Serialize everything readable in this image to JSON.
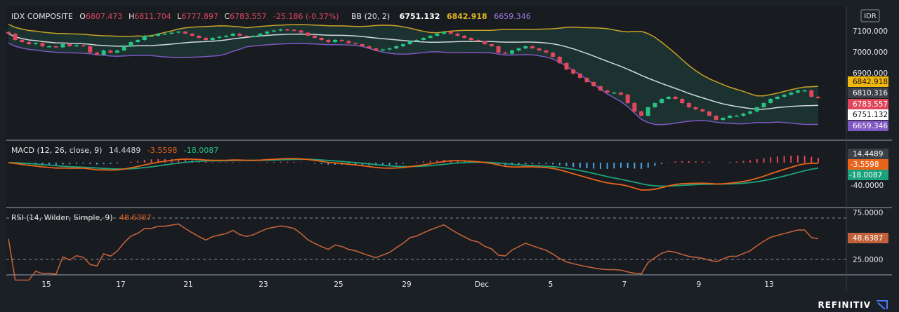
{
  "header": {
    "symbol": "IDX COMPOSITE",
    "o_label": "O",
    "o_value": "6807.473",
    "h_label": "H",
    "h_value": "6811.704",
    "l_label": "L",
    "l_value": "6777.897",
    "c_label": "C",
    "c_value": "6783.557",
    "change": "-25.186 (-0.37%)",
    "bb_label": "BB (20, 2)",
    "bb_mid": "6751.132",
    "bb_upper": "6842.918",
    "bb_lower": "6659.346",
    "currency": "IDR"
  },
  "macd_header": {
    "label": "MACD (12, 26, close, 9)",
    "hist": "14.4489",
    "macd": "-3.5598",
    "signal": "-18.0087"
  },
  "rsi_header": {
    "label": "RSI (14, Wilder, Simple, 9)",
    "value": "48.6387"
  },
  "price_axis": {
    "ticks": [
      "7100.000",
      "7000.000",
      "6900.000"
    ]
  },
  "price_tags": {
    "bb_upper": "6842.918",
    "last_rsi_ma": "6810.316",
    "close": "6783.557",
    "bb_mid": "6751.132",
    "bb_lower": "6659.346"
  },
  "macd_axis": {
    "hist": "14.4489",
    "macd": "-3.5598",
    "signal": "-18.0087",
    "tick": "-40.0000"
  },
  "rsi_axis": {
    "upper": "75.0000",
    "value": "48.6387",
    "lower": "25.0000"
  },
  "x_axis": {
    "labels": [
      "15",
      "17",
      "21",
      "23",
      "25",
      "29",
      "Dec",
      "5",
      "7",
      "9",
      "13"
    ]
  },
  "footer": {
    "brand": "REFINITIV"
  },
  "colors": {
    "up": "#26c281",
    "down": "#e0475b",
    "bb_upper": "#c9a227",
    "bb_mid": "#cfd8dc",
    "bb_lower": "#7e57c2",
    "macd": "#e8641a",
    "signal": "#1aa37a",
    "rsi": "#c0613a",
    "hist_pos": "#e0475b",
    "hist_neg": "#4aa3df"
  },
  "chart_data": [
    {
      "type": "candlestick",
      "title": "IDX COMPOSITE",
      "x_labels": [
        "15",
        "17",
        "21",
        "23",
        "25",
        "29",
        "Dec",
        "5",
        "7",
        "9",
        "13"
      ],
      "ylim": [
        6620,
        7150
      ],
      "close": [
        7090,
        7060,
        7050,
        7040,
        7045,
        7030,
        7030,
        7025,
        7040,
        7030,
        7035,
        7030,
        7000,
        6990,
        7010,
        7000,
        7010,
        7030,
        7050,
        7060,
        7080,
        7080,
        7090,
        7090,
        7095,
        7100,
        7090,
        7080,
        7070,
        7060,
        7070,
        7075,
        7080,
        7090,
        7080,
        7075,
        7080,
        7090,
        7100,
        7105,
        7110,
        7108,
        7105,
        7095,
        7080,
        7070,
        7060,
        7050,
        7060,
        7055,
        7045,
        7040,
        7030,
        7020,
        7010,
        7015,
        7020,
        7030,
        7040,
        7055,
        7060,
        7070,
        7080,
        7090,
        7100,
        7090,
        7080,
        7070,
        7060,
        7055,
        7040,
        7030,
        7000,
        6995,
        7010,
        7020,
        7030,
        7020,
        7010,
        7000,
        6980,
        6950,
        6920,
        6900,
        6880,
        6860,
        6840,
        6820,
        6810,
        6810,
        6800,
        6760,
        6720,
        6700,
        6740,
        6760,
        6780,
        6790,
        6780,
        6760,
        6740,
        6730,
        6720,
        6700,
        6680,
        6690,
        6700,
        6700,
        6710,
        6720,
        6740,
        6760,
        6780,
        6790,
        6800,
        6810,
        6820,
        6820,
        6790,
        6784
      ]
    },
    {
      "type": "line",
      "title": "MACD (12, 26, close, 9)",
      "series": [
        {
          "name": "MACD"
        },
        {
          "name": "Signal"
        },
        {
          "name": "Histogram"
        }
      ],
      "last": {
        "histogram": 14.4489,
        "macd": -3.5598,
        "signal": -18.0087
      }
    },
    {
      "type": "line",
      "title": "RSI (14, Wilder, Simple, 9)",
      "ylim": [
        0,
        100
      ],
      "levels": [
        75,
        25
      ],
      "last": 48.6387
    }
  ]
}
